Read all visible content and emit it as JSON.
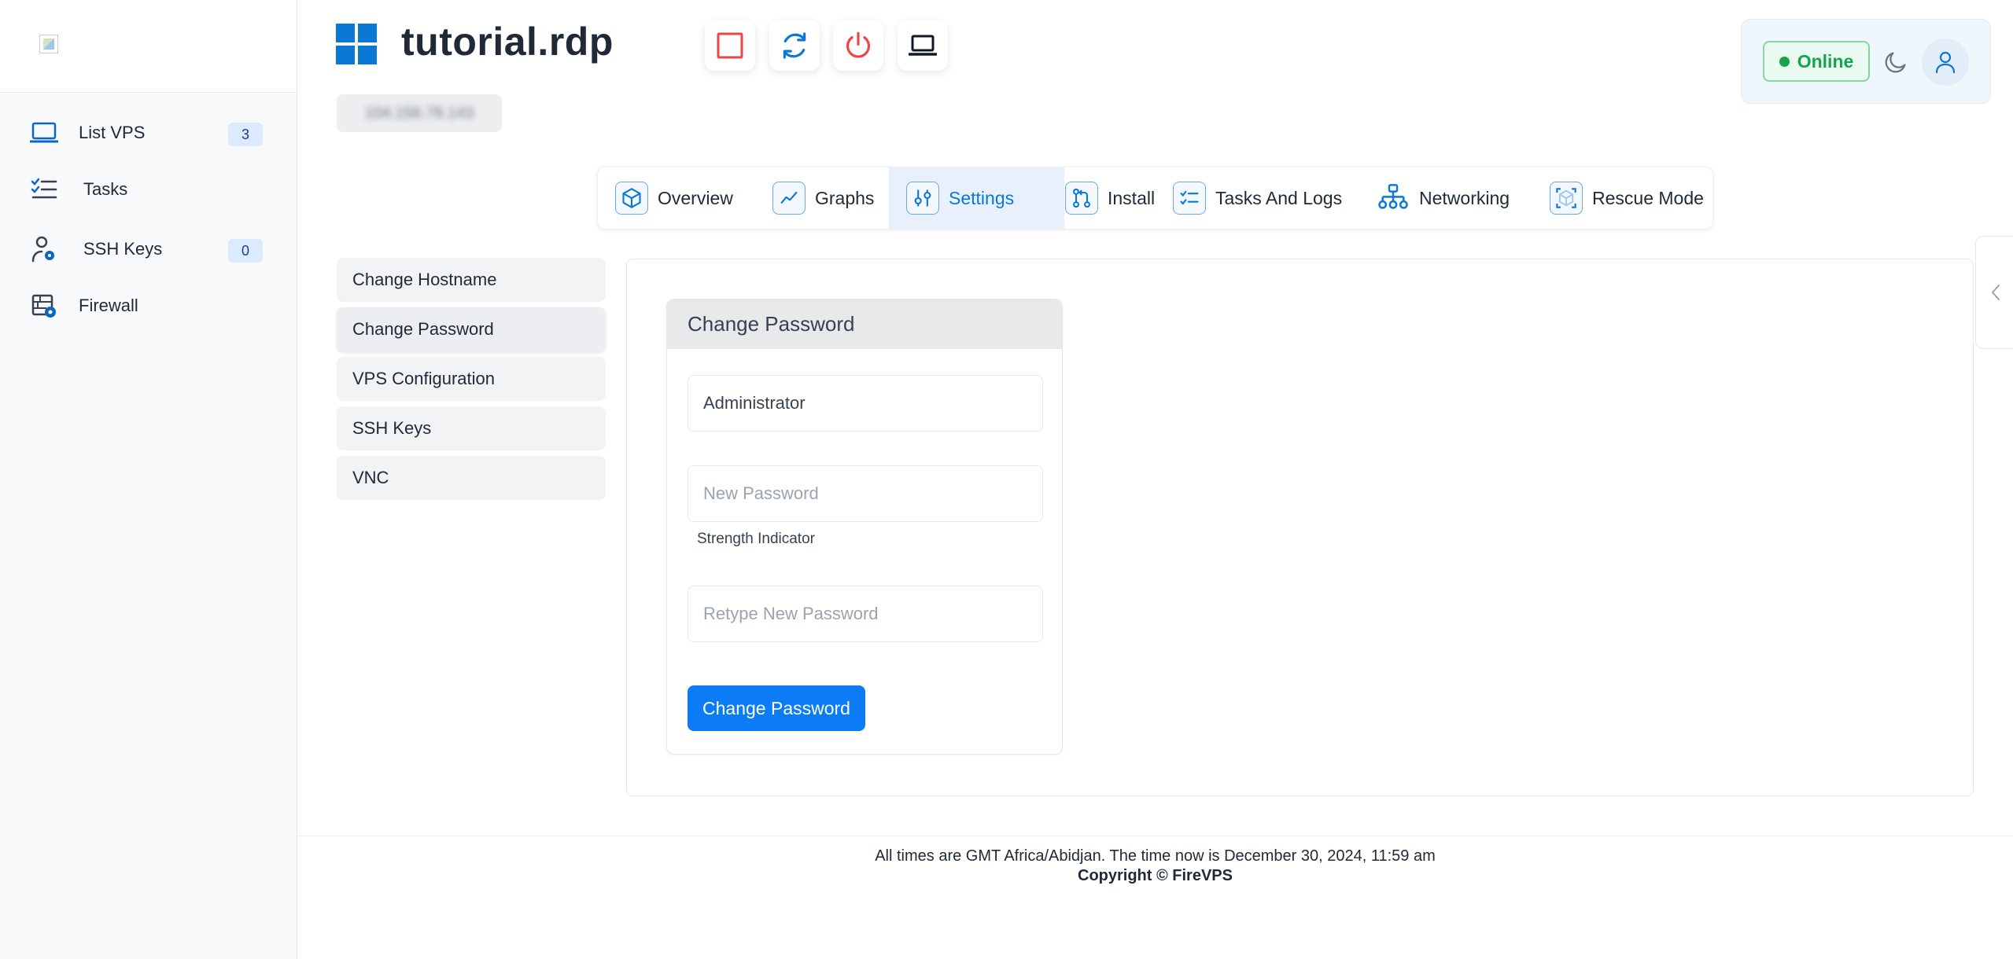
{
  "sidebar": {
    "items": [
      {
        "label": "List VPS",
        "badge": "3",
        "icon": "laptop-icon"
      },
      {
        "label": "Tasks",
        "icon": "checklist-icon"
      },
      {
        "label": "SSH Keys",
        "badge": "0",
        "icon": "user-key-icon"
      },
      {
        "label": "Firewall",
        "icon": "firewall-icon"
      }
    ]
  },
  "header": {
    "title": "tutorial.rdp",
    "os_icon": "windows-logo-icon",
    "ip_address": "104.156.78.143",
    "actions": [
      {
        "name": "stop",
        "icon": "stop-square-icon",
        "color": "#ef4444"
      },
      {
        "name": "reboot",
        "icon": "refresh-icon",
        "color": "#0a78d4"
      },
      {
        "name": "power",
        "icon": "power-icon",
        "color": "#ef4444"
      },
      {
        "name": "console",
        "icon": "laptop-icon",
        "color": "#111827"
      }
    ],
    "status": "Online",
    "status_color": "#16a34a"
  },
  "tabs": [
    {
      "label": "Overview",
      "icon": "cube-icon"
    },
    {
      "label": "Graphs",
      "icon": "chart-line-icon"
    },
    {
      "label": "Settings",
      "icon": "sliders-icon",
      "active": true
    },
    {
      "label": "Install",
      "icon": "git-pull-icon"
    },
    {
      "label": "Tasks And Logs",
      "icon": "list-check-icon"
    },
    {
      "label": "Networking",
      "icon": "network-icon"
    },
    {
      "label": "Rescue Mode",
      "icon": "rescue-cube-icon"
    }
  ],
  "settings_menu": {
    "items": [
      "Change Hostname",
      "Change Password",
      "VPS Configuration",
      "SSH Keys",
      "VNC"
    ],
    "active": "Change Password"
  },
  "change_password": {
    "title": "Change Password",
    "username": "Administrator",
    "new_password_placeholder": "New Password",
    "strength_label": "Strength Indicator",
    "retype_placeholder": "Retype New Password",
    "submit_label": "Change Password"
  },
  "footer": {
    "time_note": "All times are GMT Africa/Abidjan. The time now is December 30, 2024, 11:59 am",
    "copyright": "Copyright © FireVPS"
  },
  "colors": {
    "accent": "#0b7cf5",
    "brand_blue": "#0a78d4",
    "danger": "#ef4444",
    "sidebar_bg": "#f8f9fb"
  }
}
